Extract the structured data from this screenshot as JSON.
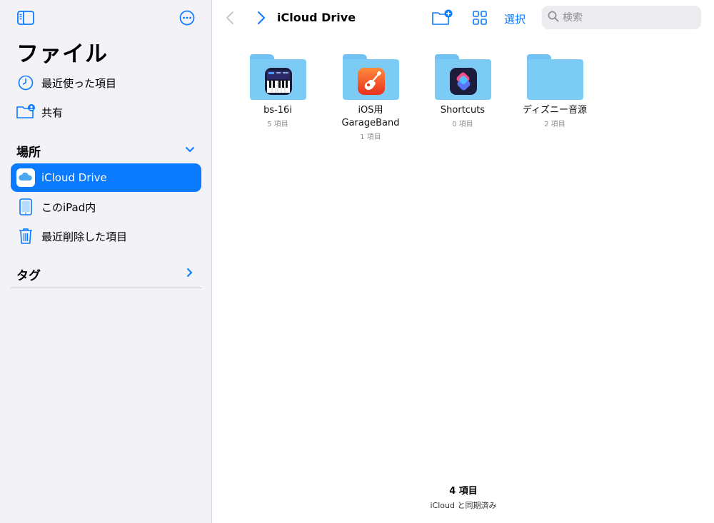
{
  "sidebar": {
    "title": "ファイル",
    "recent_label": "最近使った項目",
    "shared_label": "共有",
    "locations_header": "場所",
    "locations": [
      {
        "label": "iCloud Drive",
        "icon": "icloud-icon",
        "selected": true
      },
      {
        "label": "このiPad内",
        "icon": "ipad-icon",
        "selected": false
      },
      {
        "label": "最近削除した項目",
        "icon": "trash-icon",
        "selected": false
      }
    ],
    "tags_header": "タグ"
  },
  "toolbar": {
    "title": "iCloud Drive",
    "select_label": "選択",
    "search_placeholder": "検索"
  },
  "items": [
    {
      "name": "bs-16i",
      "count": "5 項目",
      "app_icon": "synth-keyboard-icon"
    },
    {
      "name": "iOS用\nGarageBand",
      "name_line1": "iOS用",
      "name_line2": "GarageBand",
      "count": "1 項目",
      "app_icon": "garageband-guitar-icon"
    },
    {
      "name": "Shortcuts",
      "count": "0 項目",
      "app_icon": "shortcuts-icon"
    },
    {
      "name": "ディズニー音源",
      "count": "2 項目",
      "app_icon": ""
    }
  ],
  "footer": {
    "count": "4 項目",
    "sync_status": "iCloud と同期済み"
  },
  "colors": {
    "accent": "#0a7aff",
    "folder": "#7ccbf5",
    "sidebar_bg": "#f2f2f7"
  }
}
